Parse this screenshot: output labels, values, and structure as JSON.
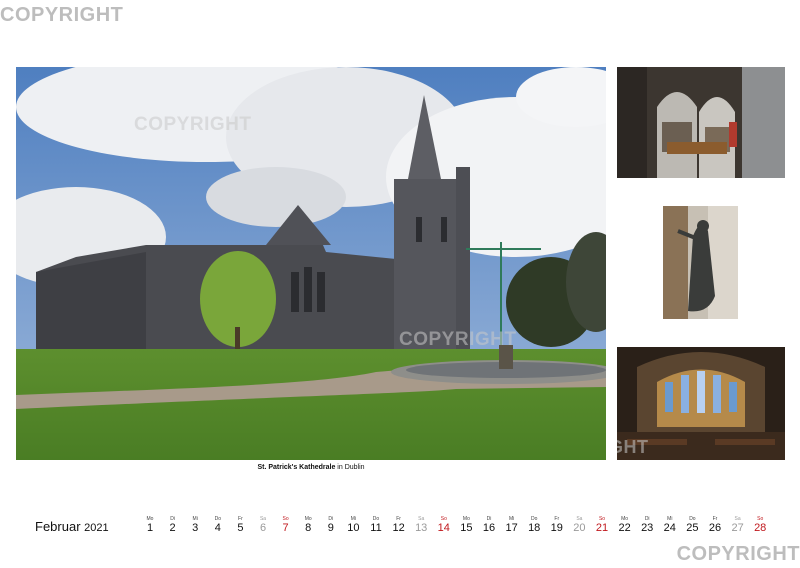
{
  "watermark": "COPYRIGHT",
  "caption": {
    "title": "St. Patrick's Kathedrale",
    "rest": " in Dublin"
  },
  "calendar": {
    "month": "Februar",
    "year": "2021",
    "days": [
      {
        "wd": "Mo",
        "n": "1",
        "t": "w"
      },
      {
        "wd": "Di",
        "n": "2",
        "t": "w"
      },
      {
        "wd": "Mi",
        "n": "3",
        "t": "w"
      },
      {
        "wd": "Do",
        "n": "4",
        "t": "w"
      },
      {
        "wd": "Fr",
        "n": "5",
        "t": "w"
      },
      {
        "wd": "Sa",
        "n": "6",
        "t": "sat"
      },
      {
        "wd": "So",
        "n": "7",
        "t": "sun"
      },
      {
        "wd": "Mo",
        "n": "8",
        "t": "w"
      },
      {
        "wd": "Di",
        "n": "9",
        "t": "w"
      },
      {
        "wd": "Mi",
        "n": "10",
        "t": "w"
      },
      {
        "wd": "Do",
        "n": "11",
        "t": "w"
      },
      {
        "wd": "Fr",
        "n": "12",
        "t": "w"
      },
      {
        "wd": "Sa",
        "n": "13",
        "t": "sat"
      },
      {
        "wd": "So",
        "n": "14",
        "t": "sun"
      },
      {
        "wd": "Mo",
        "n": "15",
        "t": "w"
      },
      {
        "wd": "Di",
        "n": "16",
        "t": "w"
      },
      {
        "wd": "Mi",
        "n": "17",
        "t": "w"
      },
      {
        "wd": "Do",
        "n": "18",
        "t": "w"
      },
      {
        "wd": "Fr",
        "n": "19",
        "t": "w"
      },
      {
        "wd": "Sa",
        "n": "20",
        "t": "sat"
      },
      {
        "wd": "So",
        "n": "21",
        "t": "sun"
      },
      {
        "wd": "Mo",
        "n": "22",
        "t": "w"
      },
      {
        "wd": "Di",
        "n": "23",
        "t": "w"
      },
      {
        "wd": "Mi",
        "n": "24",
        "t": "w"
      },
      {
        "wd": "Do",
        "n": "25",
        "t": "w"
      },
      {
        "wd": "Fr",
        "n": "26",
        "t": "w"
      },
      {
        "wd": "Sa",
        "n": "27",
        "t": "sat"
      },
      {
        "wd": "So",
        "n": "28",
        "t": "sun"
      }
    ]
  },
  "colors": {
    "weekend_sunday": "#c0181d",
    "weekend_saturday": "#9a9a9a"
  }
}
